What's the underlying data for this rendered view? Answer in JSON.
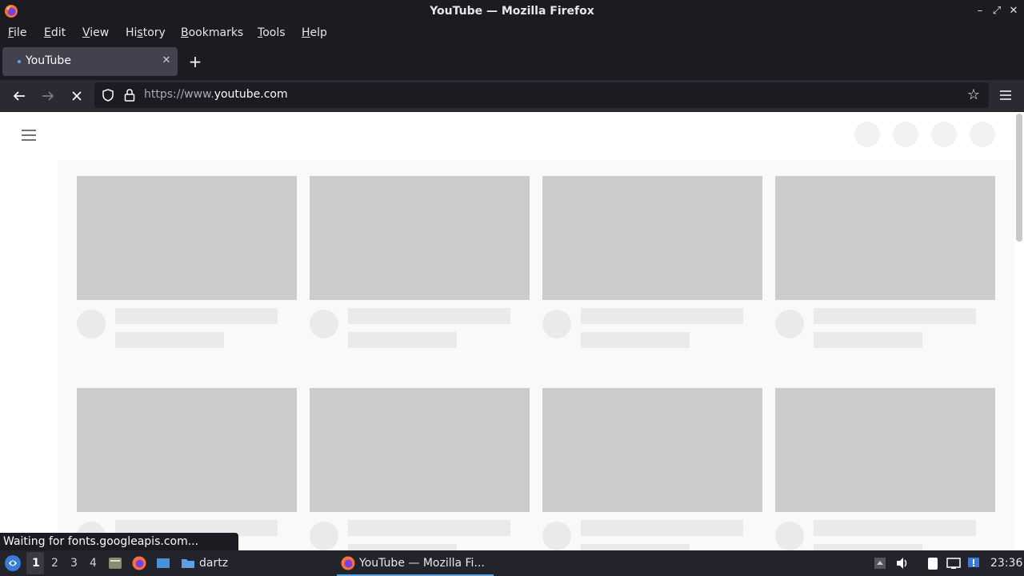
{
  "window": {
    "title": "YouTube — Mozilla Firefox"
  },
  "menubar": {
    "items": [
      {
        "label": "File",
        "accel": "F",
        "rest": "ile"
      },
      {
        "label": "Edit",
        "accel": "E",
        "rest": "dit"
      },
      {
        "label": "View",
        "accel": "V",
        "rest": "iew"
      },
      {
        "label": "History",
        "pre": "Hi",
        "accel": "s",
        "rest": "tory"
      },
      {
        "label": "Bookmarks",
        "accel": "B",
        "rest": "ookmarks"
      },
      {
        "label": "Tools",
        "accel": "T",
        "rest": "ools"
      },
      {
        "label": "Help",
        "accel": "H",
        "rest": "elp"
      }
    ]
  },
  "tabs": [
    {
      "label": "YouTube",
      "loading": true
    }
  ],
  "navbar": {
    "url_prefix": "https://www.",
    "url_domain": "youtube.com"
  },
  "status_text": "Waiting for fonts.googleapis.com...",
  "taskbar": {
    "workspaces": [
      "1",
      "2",
      "3",
      "4"
    ],
    "active_workspace": "1",
    "folder_label": "dartz",
    "task_label": "YouTube — Mozilla Fi...",
    "clock": "23:36"
  },
  "colors": {
    "chrome_bg": "#1c1b22",
    "toolbar_bg": "#2b2a33",
    "placeholder_thumb": "#cccccc",
    "placeholder_text": "#eaeaea",
    "accent": "#54a2ff"
  }
}
